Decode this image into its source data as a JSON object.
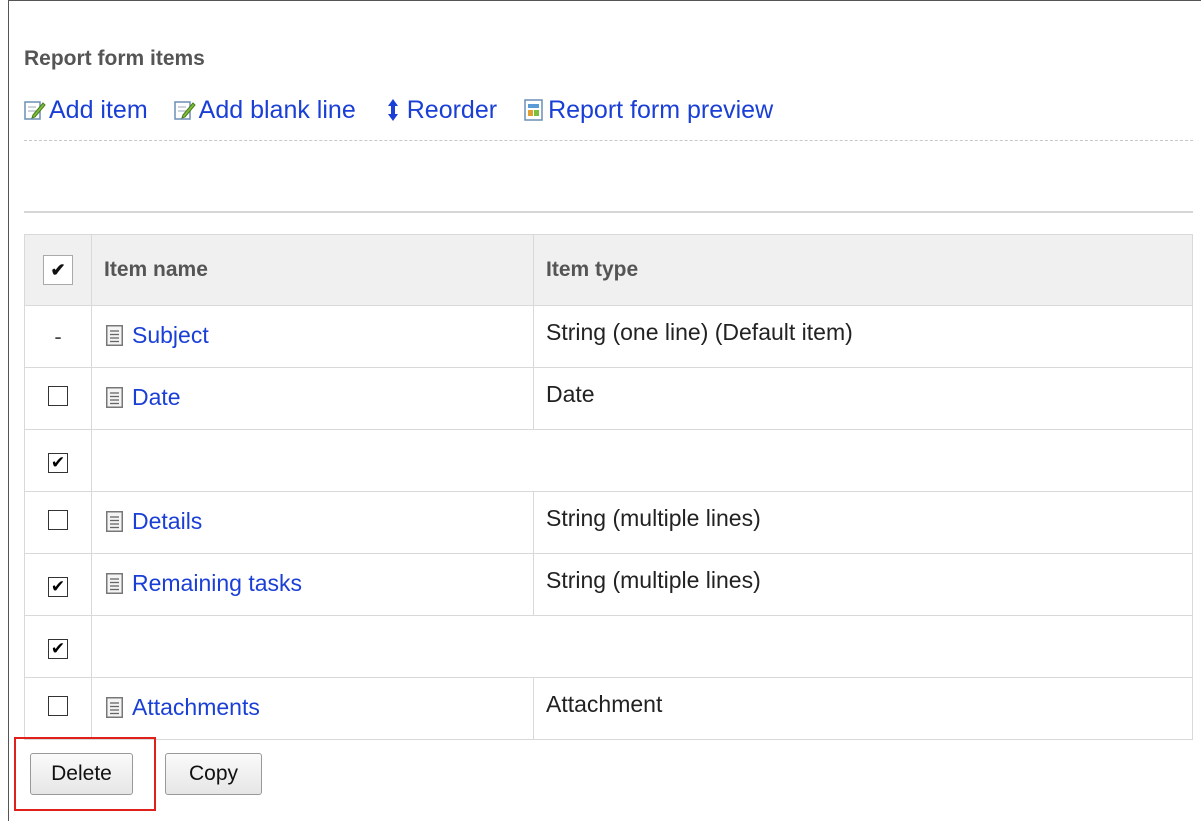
{
  "section": {
    "title": "Report form items"
  },
  "toolbar": {
    "add_item": "Add item",
    "add_blank_line": "Add blank line",
    "reorder": "Reorder",
    "report_form_preview": "Report form preview"
  },
  "table": {
    "header_check": "✔",
    "columns": [
      "Item name",
      "Item type"
    ],
    "rows": [
      {
        "check": "-",
        "checked": null,
        "name": "Subject",
        "type": "String (one line) (Default item)"
      },
      {
        "check": "",
        "checked": false,
        "name": "Date",
        "type": "Date"
      },
      {
        "check": "✔",
        "checked": true,
        "name": "",
        "type": ""
      },
      {
        "check": "",
        "checked": false,
        "name": "Details",
        "type": "String (multiple lines)"
      },
      {
        "check": "✔",
        "checked": true,
        "name": "Remaining tasks",
        "type": "String (multiple lines)"
      },
      {
        "check": "✔",
        "checked": true,
        "name": "",
        "type": ""
      },
      {
        "check": "",
        "checked": false,
        "name": "Attachments",
        "type": "Attachment"
      }
    ]
  },
  "buttons": {
    "delete": "Delete",
    "copy": "Copy"
  },
  "colors": {
    "link": "#1a3fd6",
    "highlight": "#e0201a"
  },
  "icons": [
    "edit-icon",
    "reorder-icon",
    "preview-icon",
    "document-icon"
  ]
}
